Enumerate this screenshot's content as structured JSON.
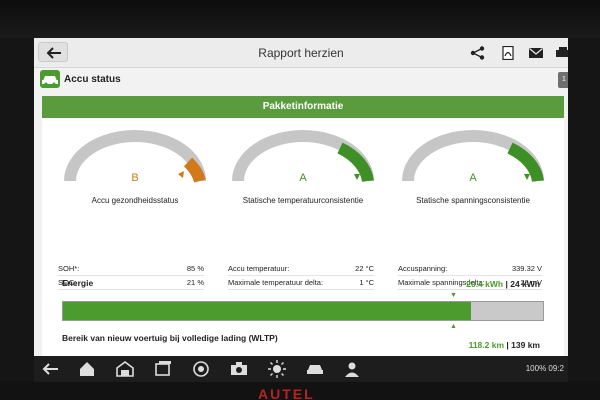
{
  "window": {
    "title": "Rapport herzien"
  },
  "section": {
    "title": "Accu status",
    "side_tab": "1"
  },
  "card": {
    "header": "Pakketinformatie"
  },
  "gauges": [
    {
      "grade": "B",
      "label": "Accu gezondheidsstatus",
      "grade_color": "#d07a1c"
    },
    {
      "grade": "A",
      "label": "Statische temperatuurconsistentie",
      "grade_color": "#3f8f27"
    },
    {
      "grade": "A",
      "label": "Statische spanningsconsistentie",
      "grade_color": "#3f8f27"
    }
  ],
  "tables": {
    "health": [
      {
        "k": "SOH*:",
        "v": "85 %"
      },
      {
        "k": "SOC:",
        "v": "21 %"
      }
    ],
    "temperature": [
      {
        "k": "Accu temperatuur:",
        "v": "22 °C"
      },
      {
        "k": "Maximale temperatuur delta:",
        "v": "1 °C"
      }
    ],
    "voltage": [
      {
        "k": "Accuspanning:",
        "v": "339.32 V"
      },
      {
        "k": "Maximale spanningsdelta:",
        "v": "26 mV"
      }
    ]
  },
  "energy": {
    "title": "Energie",
    "current": "20.4 kWh",
    "separator": "|",
    "total": "24 kWh",
    "fill_fraction": 0.85
  },
  "range": {
    "title": "Bereik van nieuw voertuig bij volledige lading (WLTP)",
    "current": "118.2 km",
    "separator": "|",
    "total": "139 km"
  },
  "status_bar": {
    "battery": "100%",
    "time": "09:2"
  },
  "brand": {
    "text": "AUTEL"
  },
  "colors": {
    "accent": "#5a9b3d",
    "warning": "#d07a1c",
    "track": "#c9c9c9"
  }
}
